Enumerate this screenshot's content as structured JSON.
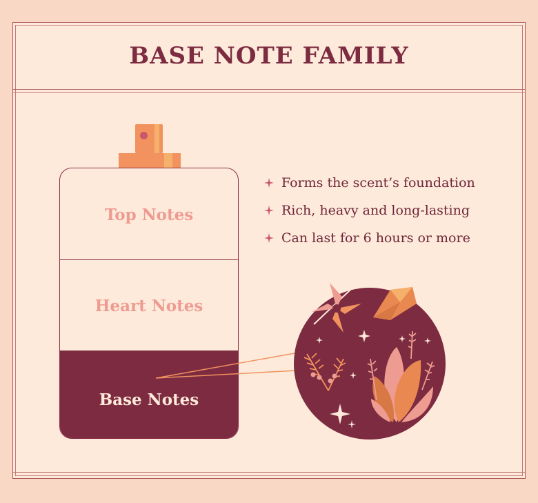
{
  "title": "BASE NOTE FAMILY",
  "layers": {
    "top": "Top Notes",
    "heart": "Heart Notes",
    "base": "Base Notes"
  },
  "bullets": [
    "Forms the scent’s foundation",
    "Rich, heavy and long-lasting",
    "Can last for 6 hours or more"
  ],
  "colors": {
    "background": "#f9d9c6",
    "panel": "#fdeadb",
    "accent": "#7c2b40",
    "pink": "#ee9c92",
    "orange": "#f2925e"
  },
  "icons": [
    "sparkle-bullet-icon",
    "vanilla-flower-icon",
    "amber-gem-icon",
    "fern-sprig-icon",
    "leafy-plant-icon",
    "twinkle-star-icon"
  ]
}
